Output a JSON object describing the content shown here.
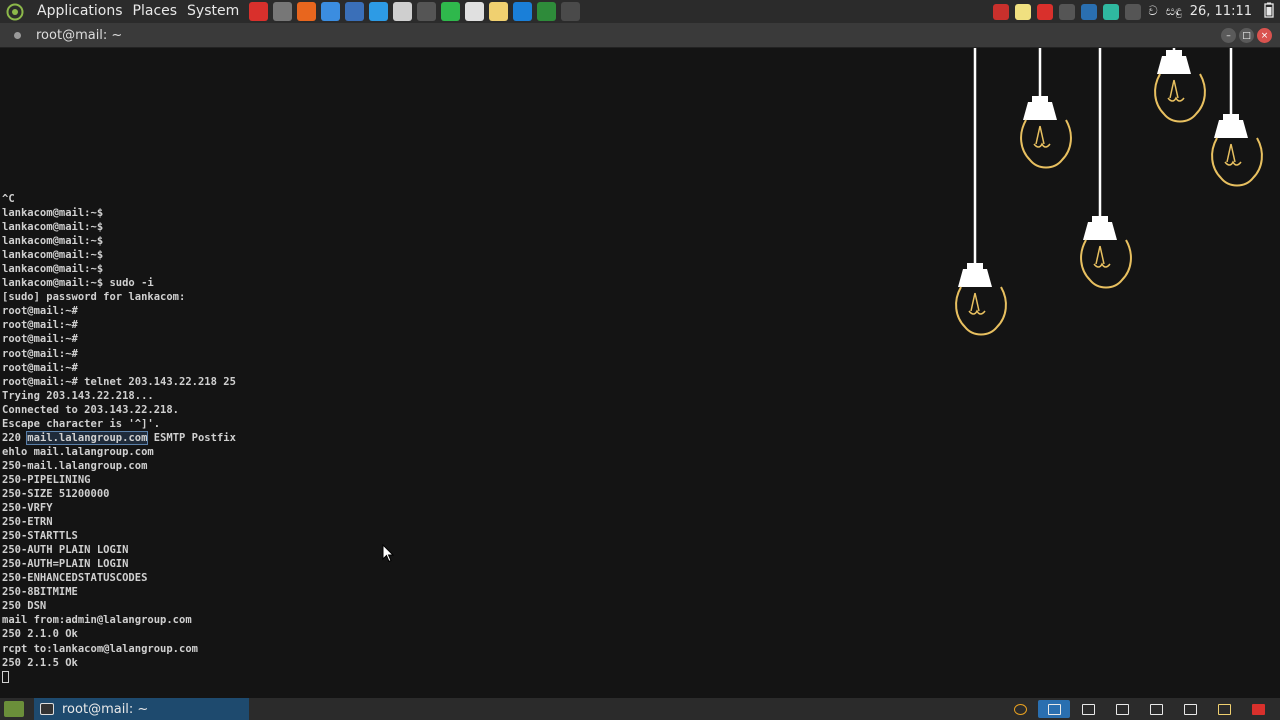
{
  "top_panel": {
    "menus": [
      "Applications",
      "Places",
      "System"
    ],
    "launchers": [
      {
        "icon": "anydesk-icon",
        "color": "#d9302c"
      },
      {
        "icon": "screenshot-icon",
        "color": "#777777"
      },
      {
        "icon": "firefox-icon",
        "color": "#e8661e"
      },
      {
        "icon": "chrome-icon",
        "color": "#3b8de0"
      },
      {
        "icon": "calculator-icon",
        "color": "#3a6fb8"
      },
      {
        "icon": "writer-icon",
        "color": "#2d9be5"
      },
      {
        "icon": "text-editor-icon",
        "color": "#cfcfcf"
      },
      {
        "icon": "terminal-icon",
        "color": "#555555"
      },
      {
        "icon": "spreadsheet-icon",
        "color": "#2fb84c"
      },
      {
        "icon": "charmap-icon",
        "color": "#e0e0e0"
      },
      {
        "icon": "notes-icon",
        "color": "#f0d070"
      },
      {
        "icon": "teamviewer-icon",
        "color": "#1a7fd8"
      },
      {
        "icon": "system-monitor-icon",
        "color": "#2e8b3a"
      },
      {
        "icon": "wireshark-icon",
        "color": "#4a4a4a"
      }
    ],
    "tray_icons": [
      {
        "icon": "record-icon",
        "color": "#c9302c"
      },
      {
        "icon": "notes-tray-icon",
        "color": "#f0e080"
      },
      {
        "icon": "anydesk-tray-icon",
        "color": "#d9302c"
      },
      {
        "icon": "search-icon",
        "color": "#555555"
      },
      {
        "icon": "bluetooth-icon",
        "color": "#2a6fb0"
      },
      {
        "icon": "network-icon",
        "color": "#2fb8a0"
      },
      {
        "icon": "volume-icon",
        "color": "#555555"
      }
    ],
    "lang_symbol": "ව",
    "lang_label": "සඳු",
    "clock": "26, 11:11"
  },
  "window": {
    "title": "root@mail: ~"
  },
  "terminal": {
    "lines": [
      "^C",
      "lankacom@mail:~$",
      "lankacom@mail:~$",
      "lankacom@mail:~$",
      "lankacom@mail:~$",
      "lankacom@mail:~$",
      "lankacom@mail:~$ sudo -i",
      "[sudo] password for lankacom:",
      "root@mail:~#",
      "root@mail:~#",
      "root@mail:~#",
      "root@mail:~#",
      "root@mail:~#",
      "root@mail:~# telnet 203.143.22.218 25",
      "Trying 203.143.22.218...",
      "Connected to 203.143.22.218.",
      "Escape character is '^]'.",
      "220 mail.lalangroup.com ESMTP Postfix",
      "ehlo mail.lalangroup.com",
      "250-mail.lalangroup.com",
      "250-PIPELINING",
      "250-SIZE 51200000",
      "250-VRFY",
      "250-ETRN",
      "250-STARTTLS",
      "250-AUTH PLAIN LOGIN",
      "250-AUTH=PLAIN LOGIN",
      "250-ENHANCEDSTATUSCODES",
      "250-8BITMIME",
      "250 DSN",
      "mail from:admin@lalangroup.com",
      "250 2.1.0 Ok",
      "rcpt to:lankacom@lalangroup.com",
      "250 2.1.5 Ok"
    ],
    "highlight": {
      "prefix": "220 ",
      "text": "mail.lalangroup.com",
      "suffix": " ESMTP Postfix"
    }
  },
  "taskbar": {
    "task_label": "root@mail: ~",
    "tray": [
      {
        "icon": "chrome-task-icon",
        "active": false
      },
      {
        "icon": "window-1-icon",
        "active": true
      },
      {
        "icon": "window-2-icon",
        "active": false
      },
      {
        "icon": "window-3-icon",
        "active": false
      },
      {
        "icon": "window-4-icon",
        "active": false
      },
      {
        "icon": "window-5-icon",
        "active": false
      },
      {
        "icon": "notes-task-icon",
        "active": false
      },
      {
        "icon": "anydesk-task-icon",
        "active": false
      }
    ]
  }
}
